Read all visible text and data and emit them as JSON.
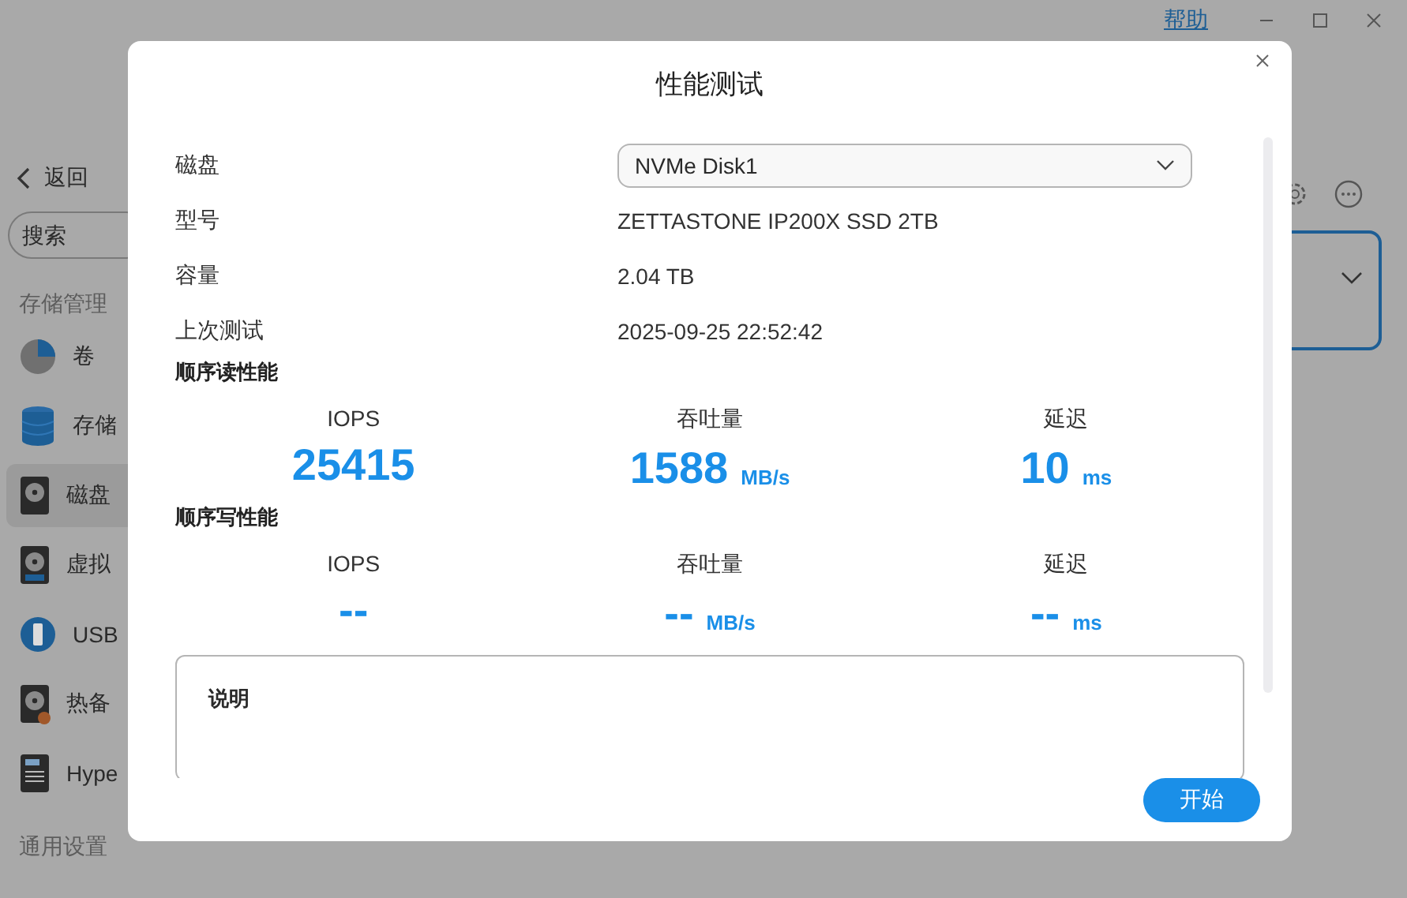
{
  "topbar": {
    "help_link": "帮助"
  },
  "sidebar": {
    "back": "返回",
    "search": {
      "placeholder": "搜索"
    },
    "section": "存储管理",
    "items": [
      {
        "label": "卷",
        "kind": "pie",
        "selected": false
      },
      {
        "label": "存储",
        "kind": "stack",
        "selected": false
      },
      {
        "label": "磁盘",
        "kind": "disk",
        "selected": true
      },
      {
        "label": "虚拟",
        "kind": "vdisk",
        "selected": false
      },
      {
        "label": "USB",
        "kind": "usb",
        "selected": false
      },
      {
        "label": "热备",
        "kind": "spare",
        "selected": false
      },
      {
        "label": "Hype",
        "kind": "ssd",
        "selected": false
      }
    ],
    "footer_section": "通用设置"
  },
  "dialog": {
    "title": "性能测试",
    "fields": [
      {
        "label": "磁盘",
        "value": "NVMe Disk1",
        "kind": "select"
      },
      {
        "label": "型号",
        "value": "ZETTASTONE IP200X SSD 2TB",
        "kind": "text"
      },
      {
        "label": "容量",
        "value": "2.04 TB",
        "kind": "text"
      },
      {
        "label": "上次测试",
        "value": "2025-09-25 22:52:42",
        "kind": "text"
      }
    ],
    "sections": [
      {
        "title": "顺序读性能",
        "metrics": [
          {
            "label": "IOPS",
            "value": "25415"
          },
          {
            "label": "吞吐量",
            "value": "1588",
            "unit": "MB/s"
          },
          {
            "label": "延迟",
            "value": "10",
            "unit": "ms"
          }
        ]
      },
      {
        "title": "顺序写性能",
        "metrics": [
          {
            "label": "IOPS",
            "value": "--"
          },
          {
            "label": "吞吐量",
            "value": "--",
            "unit": "MB/s"
          },
          {
            "label": "延迟",
            "value": "--",
            "unit": "ms"
          }
        ]
      }
    ],
    "note_title": "说明",
    "start_button": "开始"
  }
}
